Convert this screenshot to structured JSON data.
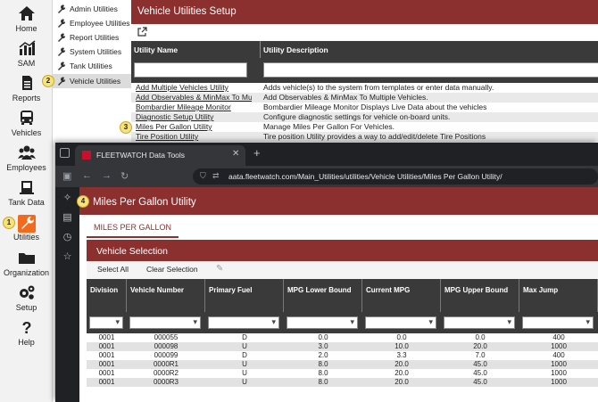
{
  "left_nav": [
    {
      "label": "Home",
      "icon": "home-icon"
    },
    {
      "label": "SAM",
      "icon": "chart-icon"
    },
    {
      "label": "Reports",
      "icon": "document-icon"
    },
    {
      "label": "Vehicles",
      "icon": "bus-icon"
    },
    {
      "label": "Employees",
      "icon": "people-icon"
    },
    {
      "label": "Tank Data",
      "icon": "tank-icon"
    },
    {
      "label": "Utilities",
      "icon": "wrench-icon"
    },
    {
      "label": "Organization",
      "icon": "folder-icon"
    },
    {
      "label": "Setup",
      "icon": "gears-icon"
    },
    {
      "label": "Help",
      "icon": "question-icon"
    }
  ],
  "submenu": [
    {
      "label": "Admin Utilities"
    },
    {
      "label": "Employee Utilities"
    },
    {
      "label": "Report Utilities"
    },
    {
      "label": "System Utilities"
    },
    {
      "label": "Tank Utilities"
    },
    {
      "label": "Vehicle Utilities"
    }
  ],
  "background_page": {
    "title": "Vehicle Utilities Setup",
    "col_name": "Utility Name",
    "col_desc": "Utility Description",
    "rows": [
      {
        "name": "Add Multiple Vehicles Utility",
        "desc": "Adds vehicle(s) to the system from templates or enter data manually."
      },
      {
        "name": "Add Observables & MinMax To Multiple Vehicles",
        "desc": "Add Observables & MinMax To Multiple Vehicles."
      },
      {
        "name": "Bombardier Mileage Monitor",
        "desc": "Bombardier Mileage Monitor Displays Live Data about the vehicles"
      },
      {
        "name": "Diagnostic Setup Utility",
        "desc": "Configure diagnostic settings for vehicle on-board units."
      },
      {
        "name": "Miles Per Gallon Utility",
        "desc": "Manage Miles Per Gallon For Vehicles."
      },
      {
        "name": "Tire Position Utility",
        "desc": "Tire position Utility provides a way to add/edit/delete Tire Positions"
      }
    ]
  },
  "badges": {
    "b1": "1",
    "b2": "2",
    "b3": "3",
    "b4": "4"
  },
  "browser": {
    "tab_title": "FLEETWATCH Data Tools",
    "url": "aata.fleetwatch.com/Main_Utilities/utilities/Vehicle Utilities/Miles Per Gallon Utility/"
  },
  "mpg": {
    "title": "Miles Per Gallon Utility",
    "tab_label": "MILES PER GALLON",
    "section_title": "Vehicle Selection",
    "select_all": "Select All",
    "clear_selection": "Clear Selection",
    "columns": [
      "Division",
      "Vehicle Number",
      "Primary Fuel",
      "MPG Lower Bound",
      "Current MPG",
      "MPG Upper Bound",
      "Max Jump"
    ],
    "rows": [
      [
        "0001",
        "000055",
        "D",
        "0.0",
        "0.0",
        "0.0",
        "400"
      ],
      [
        "0001",
        "000098",
        "U",
        "3.0",
        "10.0",
        "20.0",
        "1000"
      ],
      [
        "0001",
        "000099",
        "D",
        "2.0",
        "3.3",
        "7.0",
        "400"
      ],
      [
        "0001",
        "0000R1",
        "U",
        "8.0",
        "20.0",
        "45.0",
        "1000"
      ],
      [
        "0001",
        "0000R2",
        "U",
        "8.0",
        "20.0",
        "45.0",
        "1000"
      ],
      [
        "0001",
        "0000R3",
        "U",
        "8.0",
        "20.0",
        "45.0",
        "1000"
      ]
    ]
  },
  "colors": {
    "accent": "#8c2f2f",
    "active_nav": "#f26a1b",
    "badge": "#f7e27a",
    "browser_dark": "#202124"
  }
}
